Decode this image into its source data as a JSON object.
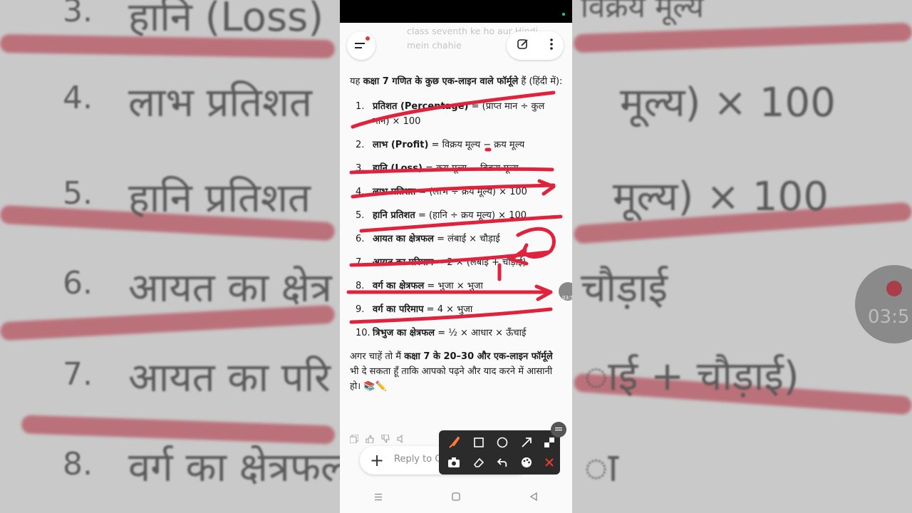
{
  "header": {
    "title": "class seventh ke ho aur Hindi mein chahie"
  },
  "intro": {
    "before": "यह ",
    "bold": "कक्षा 7 गणित के कुछ एक-लाइन वाले फॉर्मूले",
    "after": " हैं (हिंदी में):"
  },
  "formulas": [
    {
      "num": "1.",
      "term": "प्रतिशत (Percentage)",
      "rest": " = (प्राप्त मान ÷ कुल मान) × 100"
    },
    {
      "num": "2.",
      "term": "लाभ (Profit)",
      "rest": " = विक्रय मूल्य − क्रय मूल्य"
    },
    {
      "num": "3.",
      "term": "हानि (Loss)",
      "rest": " = क्रय मूल्य − विक्रय मूल्य"
    },
    {
      "num": "4.",
      "term": "लाभ प्रतिशत",
      "rest": " = (लाभ ÷ क्रय मूल्य) × 100"
    },
    {
      "num": "5.",
      "term": "हानि प्रतिशत",
      "rest": " = (हानि ÷ क्रय मूल्य) × 100"
    },
    {
      "num": "6.",
      "term": "आयत का क्षेत्रफल",
      "rest": " = लंबाई × चौड़ाई"
    },
    {
      "num": "7.",
      "term": "आयत का परिमाप",
      "rest": " = 2 × (लंबाई + चौड़ाई)"
    },
    {
      "num": "8.",
      "term": "वर्ग का क्षेत्रफल",
      "rest": " = भुजा × भुजा"
    },
    {
      "num": "9.",
      "term": "वर्ग का परिमाप",
      "rest": " = 4 × भुजा"
    },
    {
      "num": "10.",
      "term": "त्रिभुज का क्षेत्रफल",
      "rest": " = ½ × आधार × ऊँचाई"
    }
  ],
  "outro": {
    "before": "अगर चाहें तो मैं ",
    "bold": "कक्षा 7 के 20–30 और एक-लाइन फॉर्मूले",
    "after": " भी दे सकता हूँ ताकि आपको पढ़ने और याद करने में आसानी हो। 📚✏️"
  },
  "composer": {
    "plus": "+",
    "placeholder": "Reply to Ch"
  },
  "recording": {
    "time": "03:5"
  },
  "background": {
    "lines": [
      {
        "num": "3.",
        "text": "हानि (Loss)",
        "right": "विक्रय मूल्य"
      },
      {
        "num": "4.",
        "text": "लाभ प्रतिशत",
        "right": "मूल्य) × 100"
      },
      {
        "num": "5.",
        "text": "हानि प्रतिशत",
        "right": "मूल्य) × 100"
      },
      {
        "num": "6.",
        "text": "आयत का क्षेत्र",
        "right": "चौड़ाई"
      },
      {
        "num": "7.",
        "text": "आयत का परि",
        "right": "ाई + चौड़ाई)"
      },
      {
        "num": "8.",
        "text": "वर्ग का क्षेत्रफल",
        "right": "ा"
      }
    ]
  }
}
